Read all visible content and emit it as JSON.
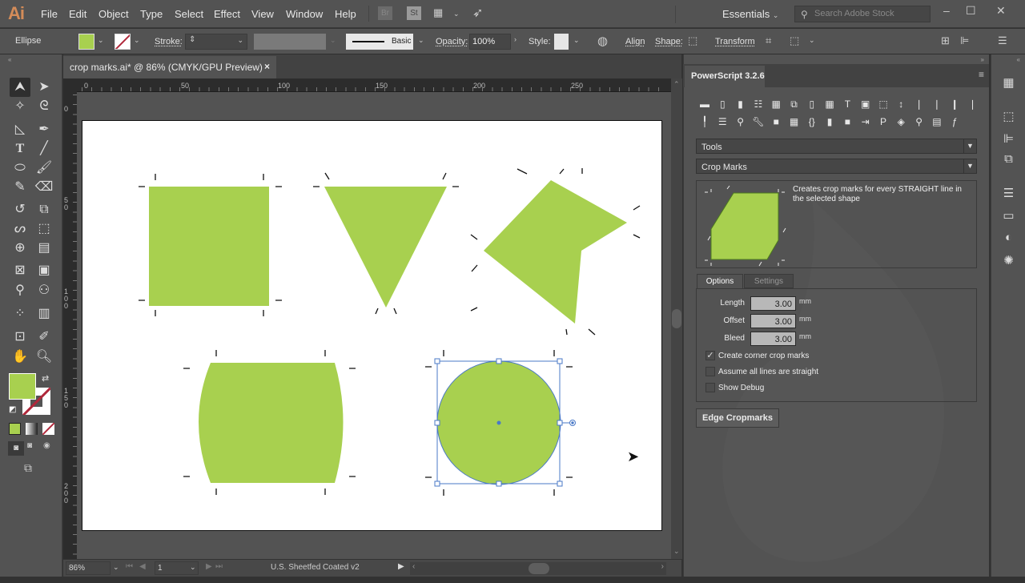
{
  "app": {
    "logo": "Ai",
    "colors": {
      "accent_fill": "#a8d04f",
      "selection": "#4a79c7",
      "ui_bg": "#535353"
    }
  },
  "menu": [
    "File",
    "Edit",
    "Object",
    "Type",
    "Select",
    "Effect",
    "View",
    "Window",
    "Help"
  ],
  "menubar_badges": {
    "bridge": "Br",
    "stock": "St"
  },
  "workspace": {
    "label": "Essentials"
  },
  "search": {
    "placeholder": "Search Adobe Stock"
  },
  "window_controls": {
    "minimize": "–",
    "maximize": "☐",
    "close": "✕"
  },
  "control_bar": {
    "object_type": "Ellipse",
    "stroke_label": "Stroke:",
    "stroke_value": "",
    "brush_label": "Basic",
    "opacity_label": "Opacity:",
    "opacity_value": "100%",
    "style_label": "Style:",
    "align_label": "Align",
    "shape_label": "Shape:",
    "transform_label": "Transform"
  },
  "document": {
    "tab_title": "crop marks.ai* @ 86% (CMYK/GPU Preview)",
    "close": "×"
  },
  "rulers": {
    "horizontal": [
      "0",
      "50",
      "100",
      "150",
      "200",
      "250"
    ],
    "vertical": [
      "0",
      "50",
      "100",
      "150",
      "200"
    ]
  },
  "status_bar": {
    "zoom": "86%",
    "artboard": "1",
    "profile": "U.S. Sheetfed Coated v2"
  },
  "panel": {
    "title": "PowerScript 3.2.6",
    "icons_row1": [
      "table-icon",
      "column-icon",
      "page-icon",
      "list-icon",
      "layout-icon",
      "overlap-icon",
      "document-icon",
      "grid-doc-icon",
      "text-icon",
      "frame-icon",
      "crop-icon",
      "resize-icon",
      "pen1-icon",
      "pen2-icon",
      "pen3-icon",
      "pen4-icon"
    ],
    "icons_row2": [
      "pin-icon",
      "split-icon",
      "zoom-image-icon",
      "wrench-icon",
      "shape-icon",
      "grid-icon",
      "braces-icon",
      "gradient-icon",
      "paper-icon",
      "export-icon",
      "pdf-icon",
      "code-file-icon",
      "search-icon",
      "spreadsheet-icon",
      "fx-icon"
    ],
    "category_select": "Tools",
    "tool_select": "Crop Marks",
    "description": "Creates crop marks for every STRAIGHT line in the selected shape",
    "tabs": [
      "Options",
      "Settings"
    ],
    "active_tab": "Options",
    "fields": [
      {
        "label": "Length",
        "value": "3.00",
        "unit": "mm"
      },
      {
        "label": "Offset",
        "value": "3.00",
        "unit": "mm"
      },
      {
        "label": "Bleed",
        "value": "3.00",
        "unit": "mm"
      }
    ],
    "checkboxes": [
      {
        "label": "Create corner crop marks",
        "checked": true
      },
      {
        "label": "Assume all lines are straight",
        "checked": false
      },
      {
        "label": "Show Debug",
        "checked": false
      }
    ],
    "action_button": "Edge Cropmarks"
  },
  "shapes": [
    "square",
    "triangle",
    "polygon",
    "barrel",
    "circle-selected"
  ]
}
